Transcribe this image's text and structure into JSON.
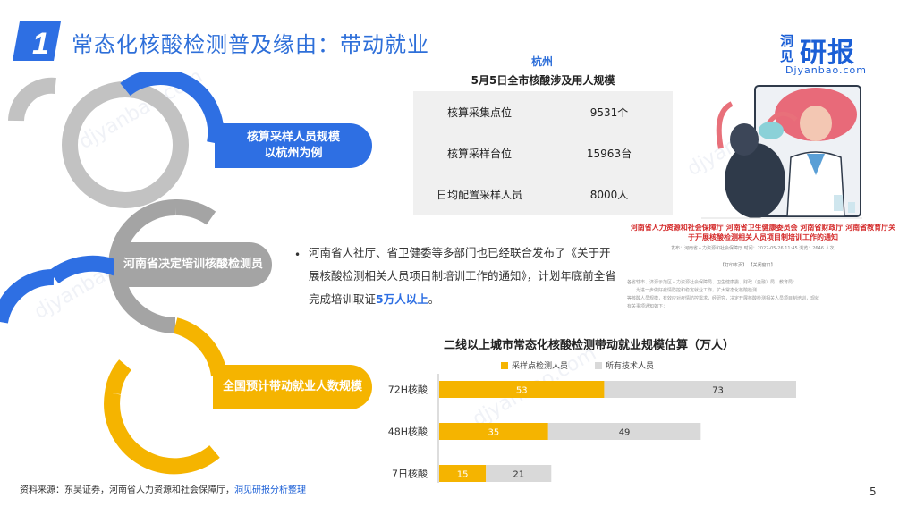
{
  "header": {
    "number": "1",
    "title": "常态化核酸检测普及缘由：带动就业",
    "logo_cn_small": "洞见",
    "logo_cn_big": "研报",
    "logo_en": "Djyanbao.com"
  },
  "left_pills": [
    {
      "label_line1": "核算采样人员规模",
      "label_line2": "以杭州为例"
    },
    {
      "label_line1": "河南省决定培训核酸检测员",
      "label_line2": ""
    },
    {
      "label_line1": "全国预计带动就业人数规模",
      "label_line2": ""
    }
  ],
  "hangzhou": {
    "city": "杭州",
    "title": "5月5日全市核酸涉及用人规模",
    "rows": [
      {
        "item": "核算采集点位",
        "value": "9531个"
      },
      {
        "item": "核算采样台位",
        "value": "15963台"
      },
      {
        "item": "日均配置采样人员",
        "value": "8000人"
      }
    ]
  },
  "notice_doc": {
    "title_line1": "河南省人力资源和社会保障厅 河南省卫生健康委员会 河南省财政厅 河南省教育厅关",
    "title_line2": "于开展核酸检测相关人员项目制培训工作的通知",
    "meta": "发布：河南省人力资源和社会保障厅    时间：2022-05-26 11:45    浏览：2646 人次",
    "tags": "【打印本页】  【关闭窗口】",
    "body_line1": "各省辖市、济源示范区人力资源社会保障局、卫生健康委、财政（金融）局、教育局：",
    "body_line2": "为进一步做好疫情防控和稳定就业工作，扩大常态化核酸检测",
    "body_line3": "等核酸人员规模，有效应对疫情防控需求，经研究，决定开展核酸检测相关人员项目制培训，现就",
    "body_line4": "有关事项通知如下："
  },
  "bullet": {
    "text": "河南省人社厅、省卫健委等多部门也已经联合发布了《关于开展核酸检测相关人员项目制培训工作的通知》，计划年底前全省完成培训取证",
    "highlight": "5万人以上",
    "end": "。"
  },
  "chart_title": "二线以上城市常态化核酸检测带动就业规模估算（万人）",
  "chart_data": {
    "type": "bar",
    "orientation": "horizontal",
    "stacked": true,
    "title": "二线以上城市常态化核酸检测带动就业规模估算（万人）",
    "categories": [
      "72H核酸",
      "48H核酸",
      "7日核酸"
    ],
    "series": [
      {
        "name": "采样点检测人员",
        "values": [
          53,
          35,
          15
        ],
        "color": "#f5b400"
      },
      {
        "name": "所有技术人员",
        "values": [
          73,
          49,
          21
        ],
        "color": "#d9d9d9"
      }
    ],
    "legend_position": "top",
    "grid": false
  },
  "footer": {
    "source_prefix": "资料来源：东吴证券，河南省人力资源和社会保障厅，",
    "source_link": "洞见研报分析整理"
  },
  "page_number": "5",
  "colors": {
    "blue": "#2e6fe3",
    "gray": "#a4a4a4",
    "yellow": "#f5b400",
    "light_gray": "#d9d9d9"
  }
}
